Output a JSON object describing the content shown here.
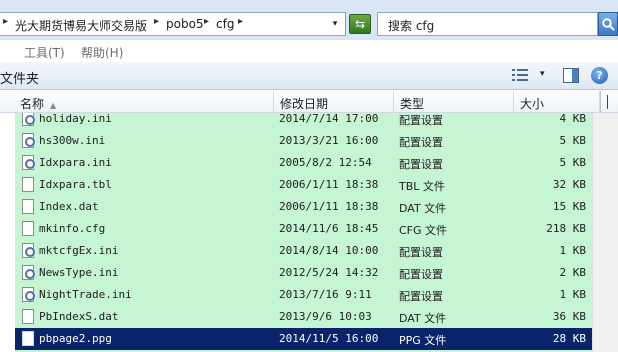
{
  "address": {
    "crumbs": [
      "光大期货博易大师交易版",
      "pobo5",
      "cfg"
    ],
    "separator": "▸",
    "dropdown": "▾"
  },
  "search": {
    "placeholder": "搜索 cfg"
  },
  "menu": {
    "items": [
      "工具(T)",
      "帮助(H)"
    ]
  },
  "toolbar": {
    "label": "文件夹",
    "help": "?"
  },
  "columns": {
    "name": "名称",
    "date": "修改日期",
    "type": "类型",
    "size": "大小"
  },
  "files": [
    {
      "name": "holiday.ini",
      "date": "2014/7/14 17:00",
      "type": "配置设置",
      "size": "4 KB",
      "icon": "config-file-icon"
    },
    {
      "name": "hs300w.ini",
      "date": "2013/3/21 16:00",
      "type": "配置设置",
      "size": "5 KB",
      "icon": "config-file-icon"
    },
    {
      "name": "Idxpara.ini",
      "date": "2005/8/2 12:54",
      "type": "配置设置",
      "size": "5 KB",
      "icon": "config-file-icon"
    },
    {
      "name": "Idxpara.tbl",
      "date": "2006/1/11 18:38",
      "type": "TBL 文件",
      "size": "32 KB",
      "icon": "file-icon"
    },
    {
      "name": "Index.dat",
      "date": "2006/1/11 18:38",
      "type": "DAT 文件",
      "size": "15 KB",
      "icon": "file-icon"
    },
    {
      "name": "mkinfo.cfg",
      "date": "2014/11/6 18:45",
      "type": "CFG 文件",
      "size": "218 KB",
      "icon": "file-icon"
    },
    {
      "name": "mktcfgEx.ini",
      "date": "2014/8/14 10:00",
      "type": "配置设置",
      "size": "1 KB",
      "icon": "config-file-icon"
    },
    {
      "name": "NewsType.ini",
      "date": "2012/5/24 14:32",
      "type": "配置设置",
      "size": "2 KB",
      "icon": "config-file-icon"
    },
    {
      "name": "NightTrade.ini",
      "date": "2013/7/16 9:11",
      "type": "配置设置",
      "size": "1 KB",
      "icon": "config-file-icon"
    },
    {
      "name": "PbIndexS.dat",
      "date": "2013/9/6 10:03",
      "type": "DAT 文件",
      "size": "36 KB",
      "icon": "file-icon"
    },
    {
      "name": "pbpage2.ppg",
      "date": "2014/11/5 16:00",
      "type": "PPG 文件",
      "size": "28 KB",
      "icon": "file-icon",
      "selected": true
    }
  ],
  "colors": {
    "list_bg": "#c6f5d4",
    "selected_bg": "#0a246a",
    "chrome_bg": "#d9e6f5"
  }
}
